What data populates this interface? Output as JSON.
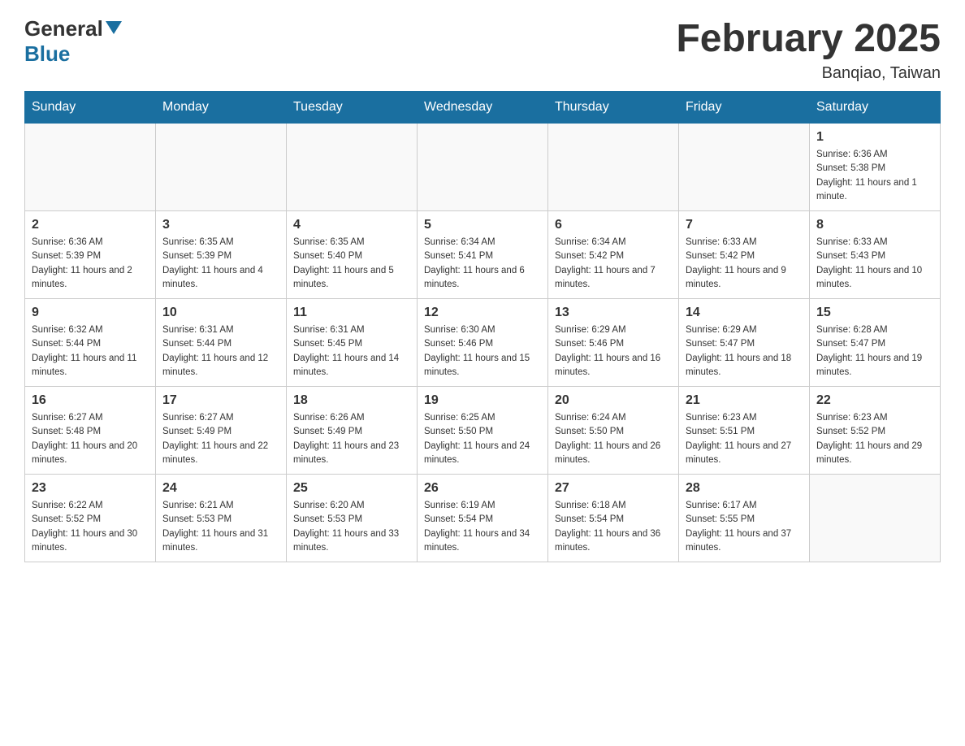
{
  "logo": {
    "general": "General",
    "blue": "Blue"
  },
  "title": {
    "month": "February 2025",
    "location": "Banqiao, Taiwan"
  },
  "headers": [
    "Sunday",
    "Monday",
    "Tuesday",
    "Wednesday",
    "Thursday",
    "Friday",
    "Saturday"
  ],
  "weeks": [
    [
      {
        "day": "",
        "info": ""
      },
      {
        "day": "",
        "info": ""
      },
      {
        "day": "",
        "info": ""
      },
      {
        "day": "",
        "info": ""
      },
      {
        "day": "",
        "info": ""
      },
      {
        "day": "",
        "info": ""
      },
      {
        "day": "1",
        "info": "Sunrise: 6:36 AM\nSunset: 5:38 PM\nDaylight: 11 hours and 1 minute."
      }
    ],
    [
      {
        "day": "2",
        "info": "Sunrise: 6:36 AM\nSunset: 5:39 PM\nDaylight: 11 hours and 2 minutes."
      },
      {
        "day": "3",
        "info": "Sunrise: 6:35 AM\nSunset: 5:39 PM\nDaylight: 11 hours and 4 minutes."
      },
      {
        "day": "4",
        "info": "Sunrise: 6:35 AM\nSunset: 5:40 PM\nDaylight: 11 hours and 5 minutes."
      },
      {
        "day": "5",
        "info": "Sunrise: 6:34 AM\nSunset: 5:41 PM\nDaylight: 11 hours and 6 minutes."
      },
      {
        "day": "6",
        "info": "Sunrise: 6:34 AM\nSunset: 5:42 PM\nDaylight: 11 hours and 7 minutes."
      },
      {
        "day": "7",
        "info": "Sunrise: 6:33 AM\nSunset: 5:42 PM\nDaylight: 11 hours and 9 minutes."
      },
      {
        "day": "8",
        "info": "Sunrise: 6:33 AM\nSunset: 5:43 PM\nDaylight: 11 hours and 10 minutes."
      }
    ],
    [
      {
        "day": "9",
        "info": "Sunrise: 6:32 AM\nSunset: 5:44 PM\nDaylight: 11 hours and 11 minutes."
      },
      {
        "day": "10",
        "info": "Sunrise: 6:31 AM\nSunset: 5:44 PM\nDaylight: 11 hours and 12 minutes."
      },
      {
        "day": "11",
        "info": "Sunrise: 6:31 AM\nSunset: 5:45 PM\nDaylight: 11 hours and 14 minutes."
      },
      {
        "day": "12",
        "info": "Sunrise: 6:30 AM\nSunset: 5:46 PM\nDaylight: 11 hours and 15 minutes."
      },
      {
        "day": "13",
        "info": "Sunrise: 6:29 AM\nSunset: 5:46 PM\nDaylight: 11 hours and 16 minutes."
      },
      {
        "day": "14",
        "info": "Sunrise: 6:29 AM\nSunset: 5:47 PM\nDaylight: 11 hours and 18 minutes."
      },
      {
        "day": "15",
        "info": "Sunrise: 6:28 AM\nSunset: 5:47 PM\nDaylight: 11 hours and 19 minutes."
      }
    ],
    [
      {
        "day": "16",
        "info": "Sunrise: 6:27 AM\nSunset: 5:48 PM\nDaylight: 11 hours and 20 minutes."
      },
      {
        "day": "17",
        "info": "Sunrise: 6:27 AM\nSunset: 5:49 PM\nDaylight: 11 hours and 22 minutes."
      },
      {
        "day": "18",
        "info": "Sunrise: 6:26 AM\nSunset: 5:49 PM\nDaylight: 11 hours and 23 minutes."
      },
      {
        "day": "19",
        "info": "Sunrise: 6:25 AM\nSunset: 5:50 PM\nDaylight: 11 hours and 24 minutes."
      },
      {
        "day": "20",
        "info": "Sunrise: 6:24 AM\nSunset: 5:50 PM\nDaylight: 11 hours and 26 minutes."
      },
      {
        "day": "21",
        "info": "Sunrise: 6:23 AM\nSunset: 5:51 PM\nDaylight: 11 hours and 27 minutes."
      },
      {
        "day": "22",
        "info": "Sunrise: 6:23 AM\nSunset: 5:52 PM\nDaylight: 11 hours and 29 minutes."
      }
    ],
    [
      {
        "day": "23",
        "info": "Sunrise: 6:22 AM\nSunset: 5:52 PM\nDaylight: 11 hours and 30 minutes."
      },
      {
        "day": "24",
        "info": "Sunrise: 6:21 AM\nSunset: 5:53 PM\nDaylight: 11 hours and 31 minutes."
      },
      {
        "day": "25",
        "info": "Sunrise: 6:20 AM\nSunset: 5:53 PM\nDaylight: 11 hours and 33 minutes."
      },
      {
        "day": "26",
        "info": "Sunrise: 6:19 AM\nSunset: 5:54 PM\nDaylight: 11 hours and 34 minutes."
      },
      {
        "day": "27",
        "info": "Sunrise: 6:18 AM\nSunset: 5:54 PM\nDaylight: 11 hours and 36 minutes."
      },
      {
        "day": "28",
        "info": "Sunrise: 6:17 AM\nSunset: 5:55 PM\nDaylight: 11 hours and 37 minutes."
      },
      {
        "day": "",
        "info": ""
      }
    ]
  ]
}
